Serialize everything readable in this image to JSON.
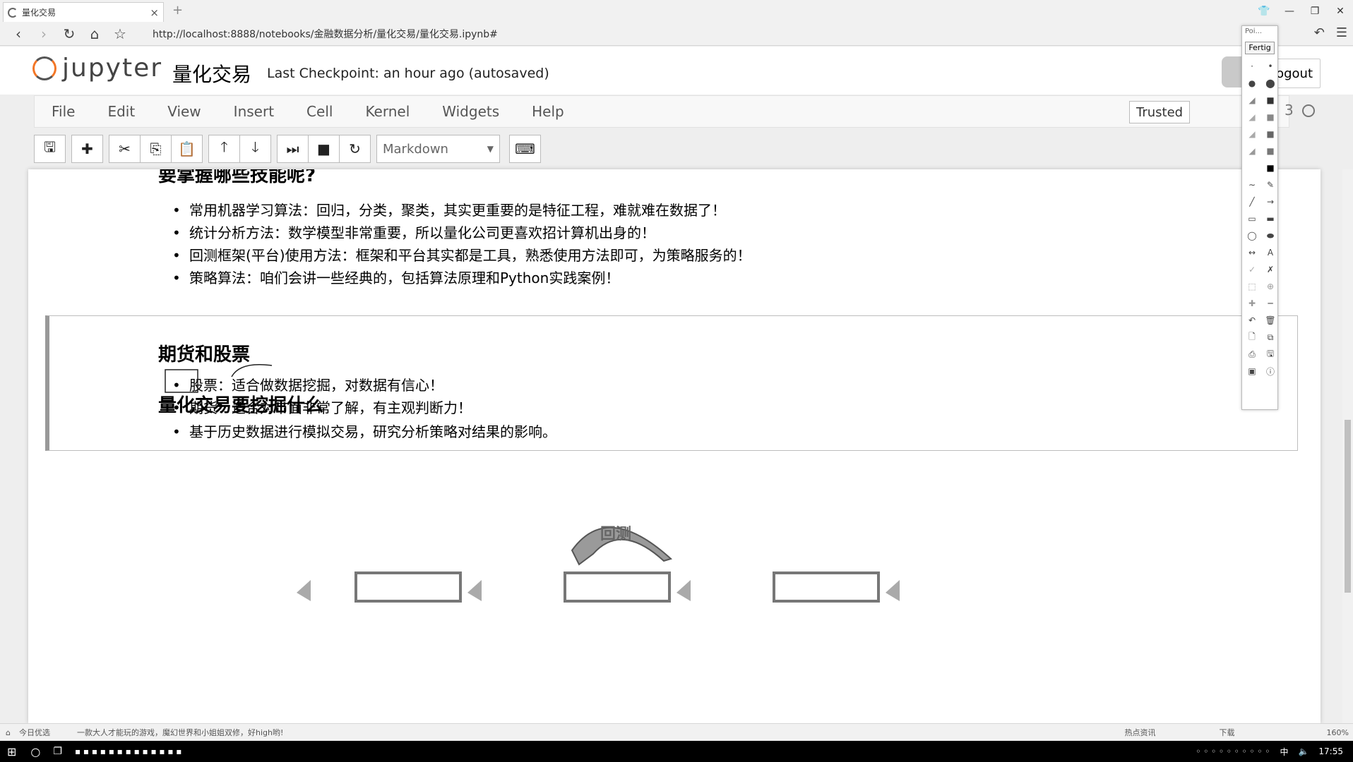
{
  "browser": {
    "tab_title": "量化交易",
    "tab_close": "×",
    "new_tab": "+",
    "url": "http://localhost:8888/notebooks/金融数据分析/量化交易/量化交易.ipynb#",
    "win_min": "—",
    "win_restore": "❐",
    "win_close": "✕"
  },
  "jupyter": {
    "logo_text": "jupyter",
    "notebook_name": "量化交易",
    "checkpoint": "Last Checkpoint: an hour ago (autosaved)",
    "logout": "ogout",
    "menu": [
      "File",
      "Edit",
      "View",
      "Insert",
      "Cell",
      "Kernel",
      "Widgets",
      "Help"
    ],
    "trusted": "Trusted",
    "kernel_partial": "3",
    "cell_type": "Markdown"
  },
  "notebook": {
    "skills_heading": "要掌握哪些技能呢?",
    "skills": [
      "常用机器学习算法：回归，分类，聚类，其实更重要的是特征工程，难就难在数据了！",
      "统计分析方法：数学模型非常重要，所以量化公司更喜欢招计算机出身的！",
      "回测框架(平台)使用方法：框架和平台其实都是工具，熟悉使用方法即可，为策略服务的！",
      "策略算法：咱们会讲一些经典的，包括算法原理和Python实践案例！"
    ],
    "futures_heading": "期货和股票",
    "futures": [
      "股票：适合做数据挖掘，对数据有信心！",
      "期货：适合对市面非常了解，有主观判断力！"
    ],
    "mining_heading": "量化交易要挖掘什么",
    "mining": [
      "基于历史数据进行模拟交易，研究分析策略对结果的影响。"
    ],
    "diagram_label": "回测"
  },
  "palette": {
    "head": "Poi...",
    "done": "Fertig"
  },
  "statusbar": {
    "left": "今日优选",
    "ad": "一款大人才能玩的游戏，魔幻世界和小姐姐双修，好high哟!",
    "news": "热点资讯",
    "download": "下载",
    "zoom": "160%"
  },
  "taskbar": {
    "ime": "中",
    "time": "17:55"
  }
}
